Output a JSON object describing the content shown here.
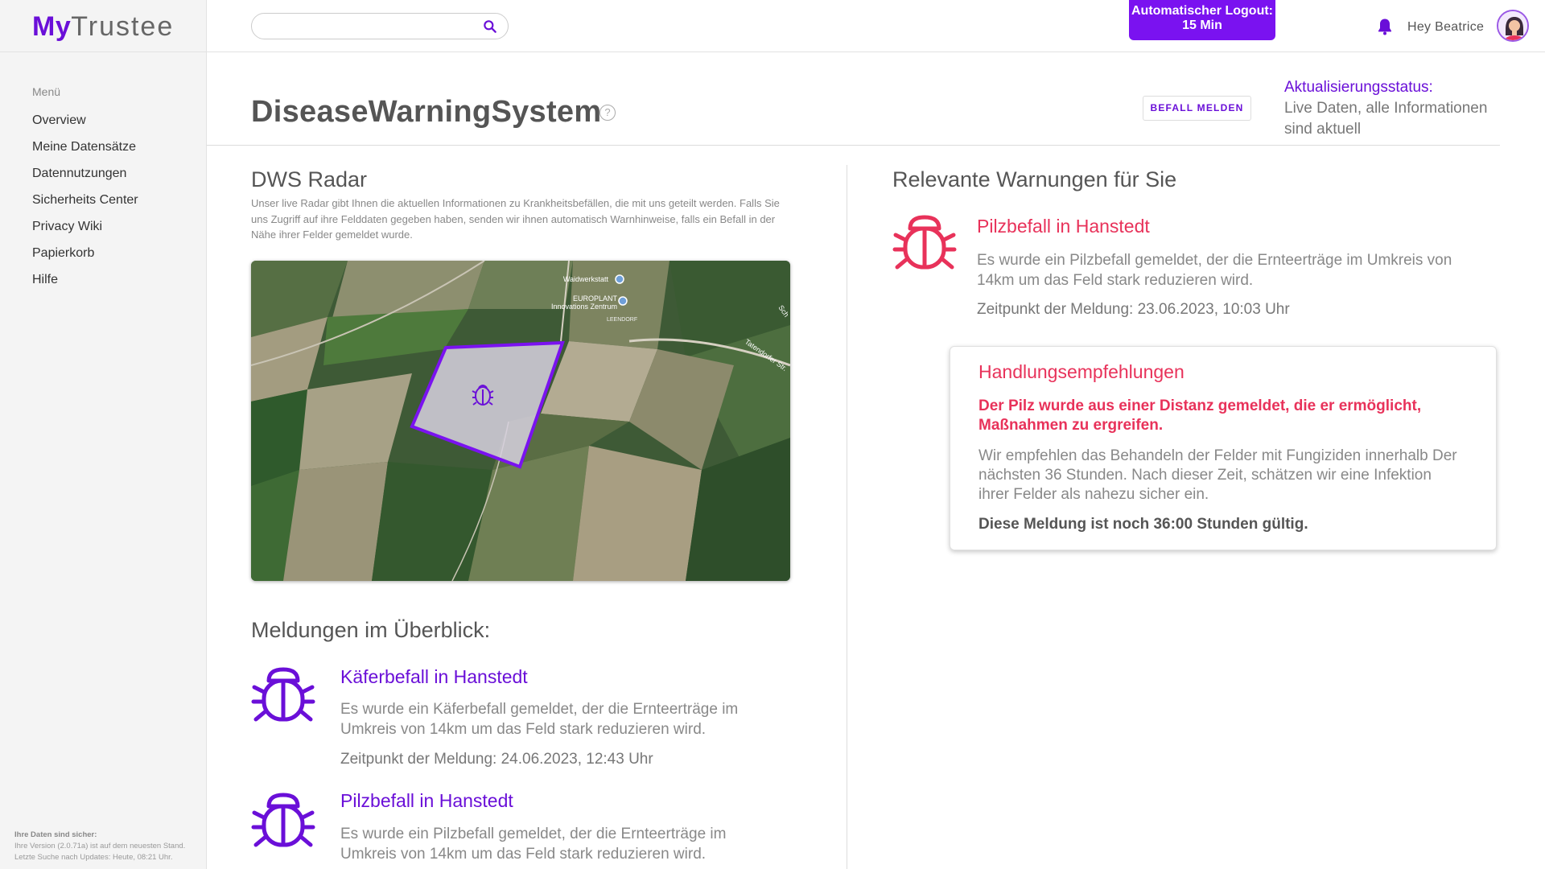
{
  "app": {
    "logo_my": "My",
    "logo_trustee": "Trustee"
  },
  "sidebar": {
    "menu_heading": "Menü",
    "items": [
      {
        "label": "Overview"
      },
      {
        "label": "Meine Datensätze"
      },
      {
        "label": "Datennutzungen"
      },
      {
        "label": "Sicherheits Center"
      },
      {
        "label": "Privacy Wiki"
      },
      {
        "label": "Papierkorb"
      },
      {
        "label": "Hilfe"
      }
    ],
    "footer": {
      "line1": "Ihre Daten sind sicher:",
      "line2": "Ihre Version (2.0.71a) ist auf dem neuesten Stand.",
      "line3": "Letzte Suche nach Updates: Heute, 08:21 Uhr."
    }
  },
  "topbar": {
    "search_placeholder": "",
    "logout_line1": "Automatischer Logout:",
    "logout_line2": "15 Min",
    "greeting": "Hey Beatrice"
  },
  "header": {
    "title": "DiseaseWarningSystem",
    "help": "?",
    "report_button": "BEFALL MELDEN",
    "status_label": "Aktualisierungsstatus:",
    "status_text": "Live Daten, alle Informationen sind aktuell"
  },
  "radar": {
    "title": "DWS Radar",
    "description": "Unser live Radar gibt Ihnen die aktuellen Informationen zu Krankheitsbefällen, die mit uns geteilt werden. Falls Sie uns Zugriff auf ihre Felddaten gegeben haben, senden wir ihnen automatisch Warnhinweise, falls ein Befall in der Nähe ihrer Felder gemeldet wurde.",
    "map_labels": {
      "poi1": "Waidwerkstatt",
      "poi2_line1": "EUROPLANT",
      "poi2_line2": "Innovations Zentrum",
      "poi3": "LEENDORF",
      "road": "Tatendorfer Str.",
      "road2": "Sch"
    }
  },
  "overview": {
    "title": "Meldungen im Überblick:",
    "items": [
      {
        "title": "Käferbefall in Hanstedt",
        "text": "Es wurde ein Käferbefall gemeldet, der die Ernteerträge im Umkreis von 14km um das Feld stark reduzieren wird.",
        "time": "Zeitpunkt der Meldung: 24.06.2023, 12:43 Uhr"
      },
      {
        "title": "Pilzbefall in Hanstedt",
        "text": "Es wurde ein Pilzbefall gemeldet, der die Ernteerträge im Umkreis von 14km um das Feld stark reduzieren wird."
      }
    ]
  },
  "relevant": {
    "title": "Relevante Warnungen für Sie",
    "warning": {
      "title": "Pilzbefall in Hanstedt",
      "text": "Es wurde ein Pilzbefall gemeldet, der die Ernteerträge im Umkreis von 14km um das Feld stark reduzieren wird.",
      "time": "Zeitpunkt der Meldung: 23.06.2023, 10:03 Uhr"
    },
    "card": {
      "title": "Handlungsempfehlungen",
      "alert": "Der Pilz wurde aus einer Distanz gemeldet, die er ermöglicht, Maßnahmen zu ergreifen.",
      "text": "Wir empfehlen das Behandeln der Felder mit Fungiziden innerhalb Der nächsten 36 Stunden. Nach dieser Zeit, schätzen wir eine Infektion ihrer Felder als nahezu sicher ein.",
      "valid": "Diese Meldung ist noch 36:00 Stunden gültig."
    }
  },
  "colors": {
    "brand": "#6a0fd8",
    "danger": "#e8325a",
    "sidebar_bg": "#f4f4f4"
  },
  "icons": [
    "search-icon",
    "bell-icon",
    "avatar",
    "help-icon",
    "bug-icon"
  ]
}
